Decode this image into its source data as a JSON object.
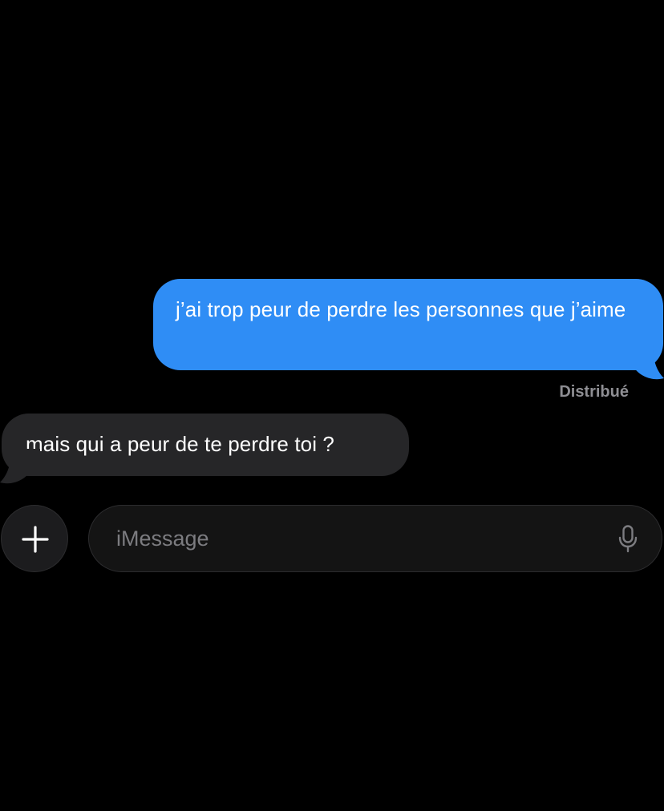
{
  "conversation": {
    "sent_message": "j’ai trop peur de perdre les personnes que j’aime",
    "receipt_status": "Distribué",
    "received_message": "mais qui a peur de te perdre toi ?"
  },
  "composer": {
    "plus_icon": "plus-icon",
    "placeholder": "iMessage",
    "mic_icon": "microphone-icon"
  },
  "colors": {
    "background": "#000000",
    "sent_bubble": "#2f8df5",
    "received_bubble": "#262628",
    "receipt_text": "#8e8e93",
    "placeholder_text": "#7c7c80"
  }
}
